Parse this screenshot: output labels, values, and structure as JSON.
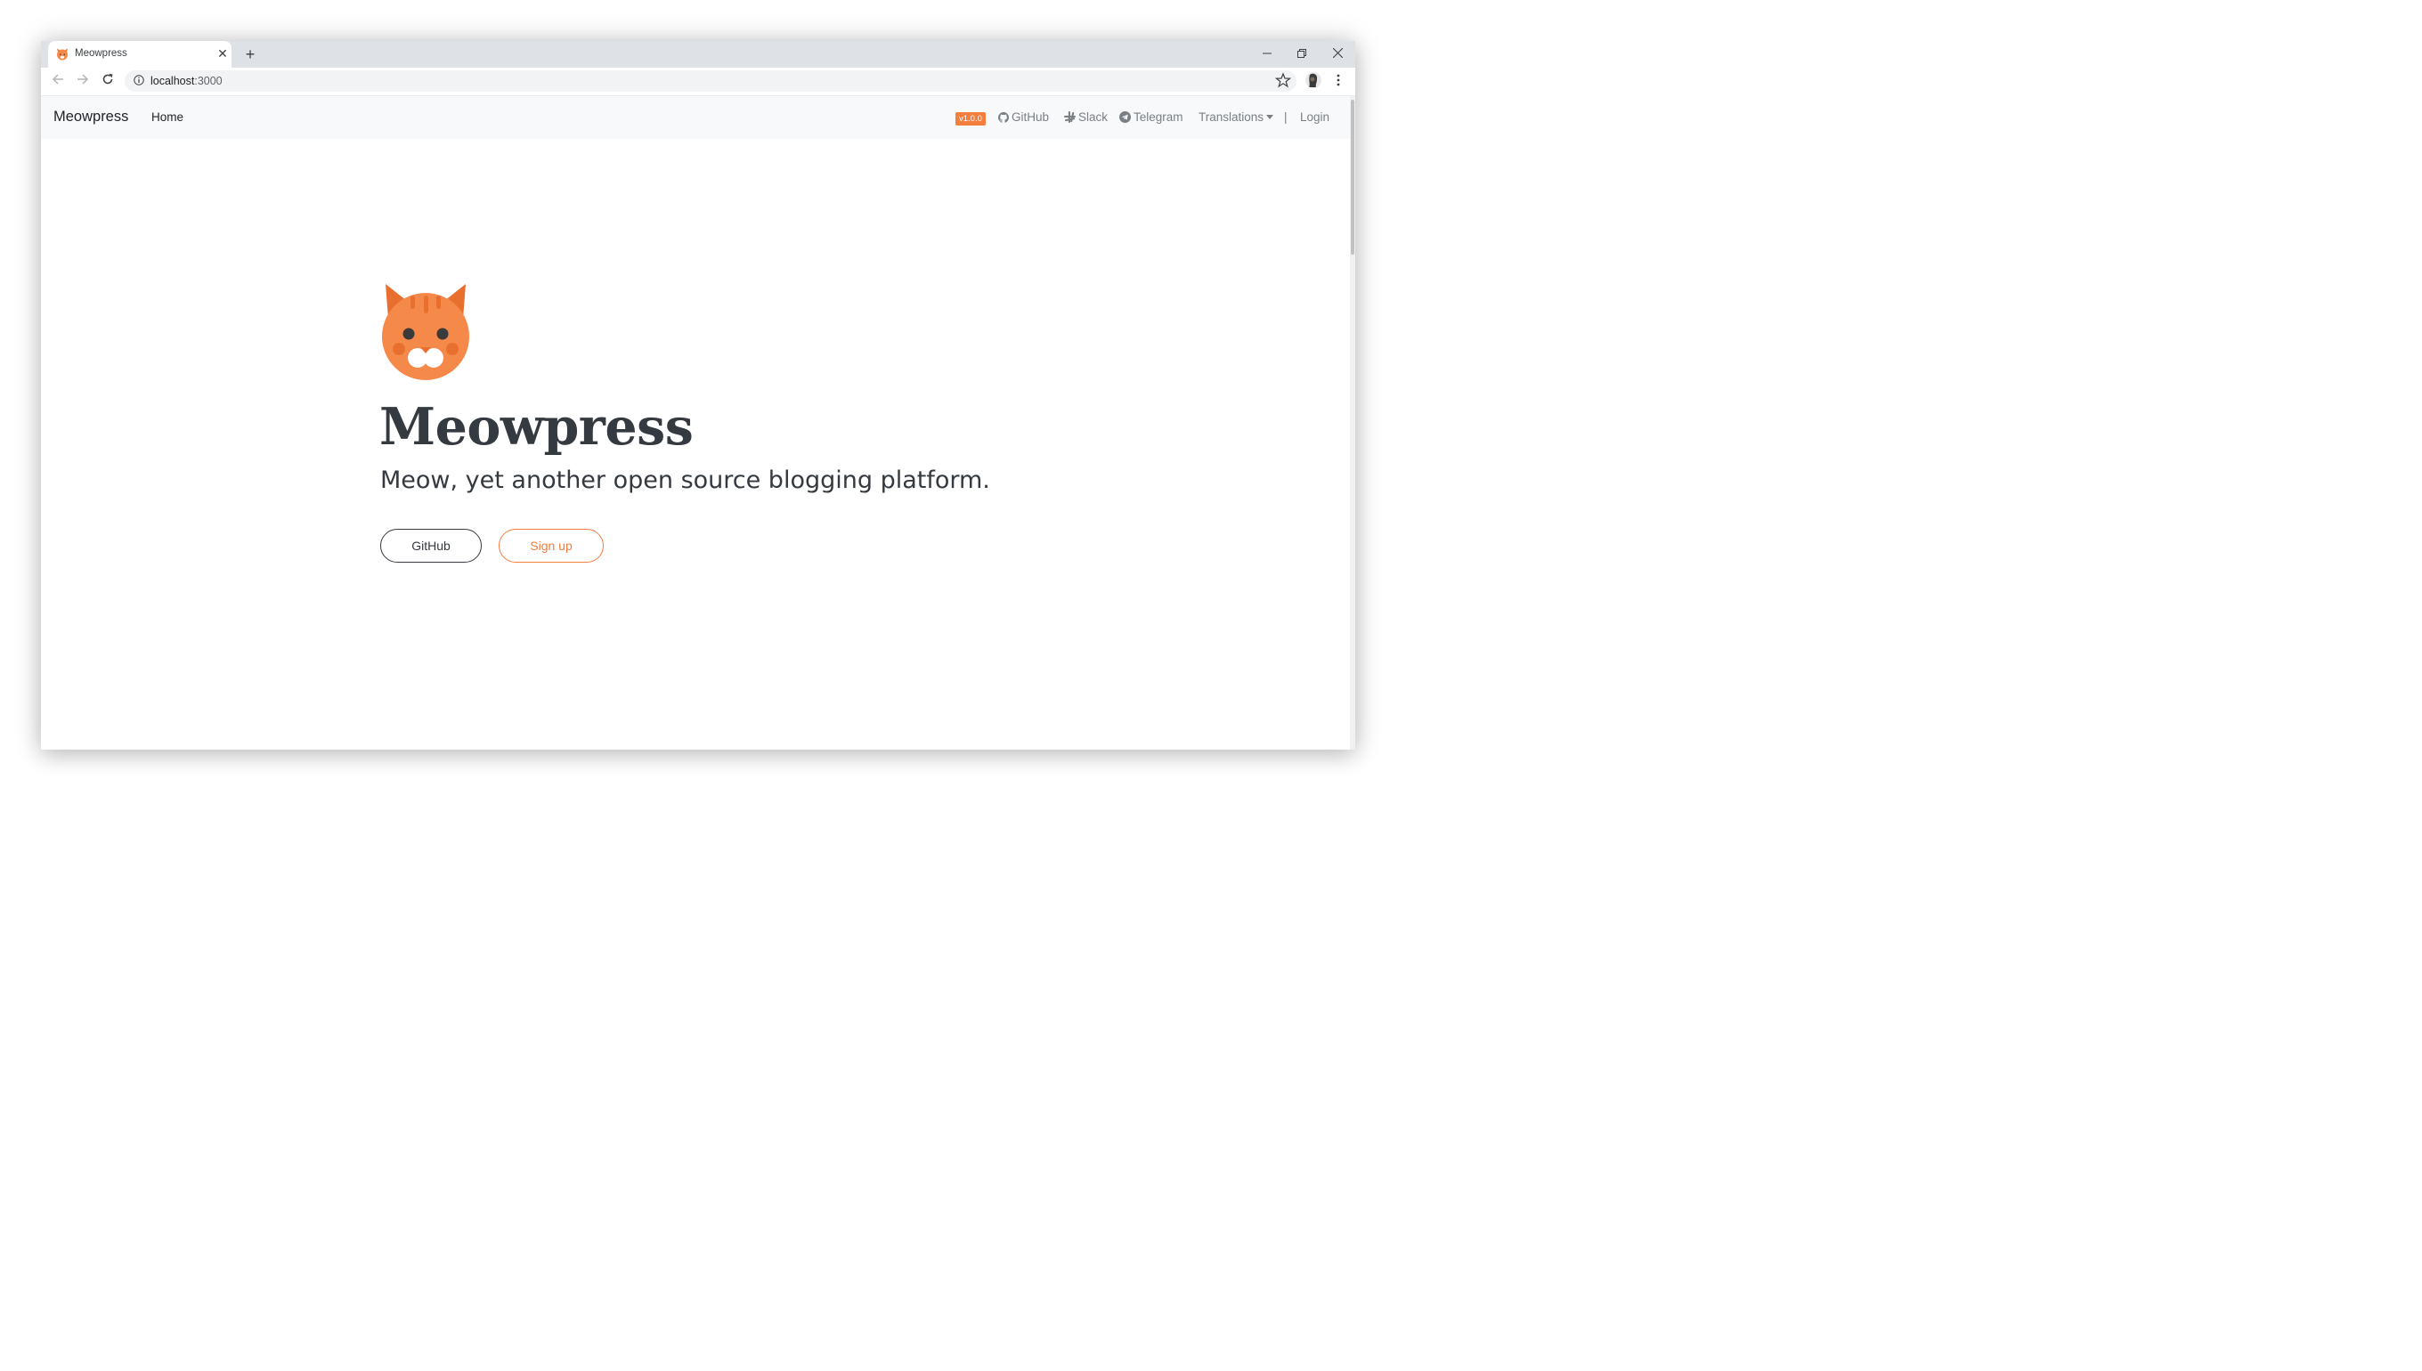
{
  "browser": {
    "tab_title": "Meowpress",
    "url_host": "localhost",
    "url_port": ":3000"
  },
  "navbar": {
    "brand": "Meowpress",
    "home": "Home",
    "version": "v1.0.0",
    "github": "GitHub",
    "slack": "Slack",
    "telegram": "Telegram",
    "translations": "Translations",
    "separator": "|",
    "login": "Login"
  },
  "hero": {
    "title": "Meowpress",
    "subtitle": "Meow, yet another open source blogging platform.",
    "github_button": "GitHub",
    "signup_button": "Sign up"
  },
  "colors": {
    "accent": "#f47e3e",
    "dark": "#343a40",
    "navbar_bg": "#f8f9fa",
    "chrome_bg": "#dee1e6"
  },
  "icons": [
    "cat-favicon-icon",
    "close-icon",
    "plus-icon",
    "minimize-icon",
    "restore-icon",
    "window-close-icon",
    "back-icon",
    "forward-icon",
    "reload-icon",
    "info-icon",
    "star-icon",
    "profile-avatar",
    "kebab-menu-icon",
    "github-icon",
    "slack-icon",
    "telegram-icon",
    "caret-down-icon",
    "cat-logo-icon"
  ]
}
